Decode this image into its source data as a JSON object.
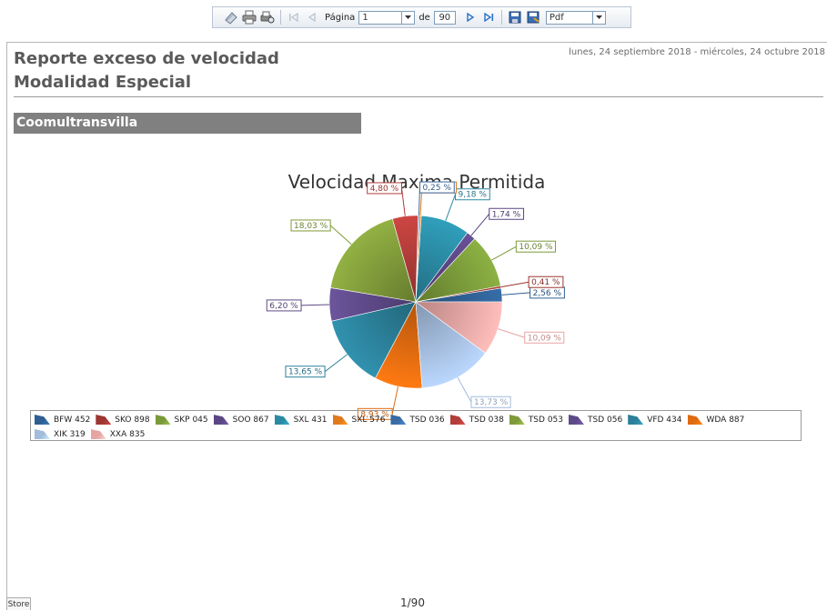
{
  "toolbar": {
    "page_label": "Página",
    "page_value": "1",
    "of_label": "de",
    "total_pages": "90",
    "format_value": "Pdf"
  },
  "report": {
    "title": "Reporte exceso de velocidad Modalidad Especial",
    "date_range": "lunes, 24 septiembre 2018 - miércoles, 24 octubre 2018",
    "company": "Coomultransvilla"
  },
  "chart_data": {
    "type": "pie",
    "title": "Velocidad Maxima Permitida",
    "slices": [
      {
        "label": "BFW 452",
        "value": 2.56,
        "text": "2,56 %",
        "color": "#2f5f92"
      },
      {
        "label": "SKO 898",
        "value": 0.41,
        "text": "0,41 %",
        "color": "#9c3631"
      },
      {
        "label": "SKP 045",
        "value": 10.09,
        "text": "10,09 %",
        "color": "#7a9a3a"
      },
      {
        "label": "SOO 867",
        "value": 1.74,
        "text": "1,74 %",
        "color": "#5b4684"
      },
      {
        "label": "SXL 431",
        "value": 9.18,
        "text": "9,18 %",
        "color": "#2a8aa3"
      },
      {
        "label": "SXL 576",
        "value": 0.33,
        "text": "0,33 %",
        "color": "#e07a1a"
      },
      {
        "label": "TSD 036",
        "value": 0.25,
        "text": "0,25 %",
        "color": "#3a6ba3"
      },
      {
        "label": "TSD 038",
        "value": 4.8,
        "text": "4,80 %",
        "color": "#b23d3a"
      },
      {
        "label": "TSD 053",
        "value": 18.03,
        "text": "18,03 %",
        "color": "#7f9a3a"
      },
      {
        "label": "TSD 056",
        "value": 6.2,
        "text": "6,20 %",
        "color": "#5e4a88"
      },
      {
        "label": "VFD 434",
        "value": 13.65,
        "text": "13,65 %",
        "color": "#2b7f98"
      },
      {
        "label": "WDA 887",
        "value": 8.93,
        "text": "8,93 %",
        "color": "#e06a10"
      },
      {
        "label": "XIK 319",
        "value": 13.73,
        "text": "13,73 %",
        "color": "#a3bbdc"
      },
      {
        "label": "XXA 835",
        "value": 10.09,
        "text": "10,09 %",
        "color": "#e6a5a3"
      }
    ],
    "legend_position": "bottom"
  },
  "footer": {
    "store_tab": "Store",
    "page_indicator": "1/90"
  }
}
